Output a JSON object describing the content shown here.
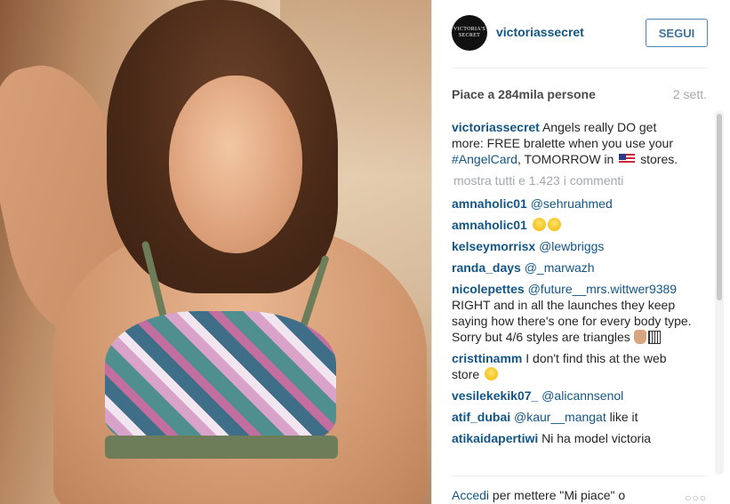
{
  "post": {
    "username": "victoriassecret",
    "avatar_text": "VICTORIA'S SECRET",
    "follow_label": "SEGUI",
    "likes_text": "Piace a 284mila persone",
    "time_text": "2 sett."
  },
  "caption": {
    "user": "victoriassecret",
    "text1": "Angels really DO get more: FREE bralette when you use your ",
    "hashtag": "#AngelCard",
    "text2": ", TOMORROW in ",
    "text3": " stores."
  },
  "show_all_text": "mostra tutti e 1.423 i commenti",
  "comments": [
    {
      "user": "amnaholic01",
      "mention": "@sehruahmed",
      "text": ""
    },
    {
      "user": "amnaholic01",
      "mention": "",
      "text": ""
    },
    {
      "user": "kelseymorrisx",
      "mention": "@lewbriggs",
      "text": ""
    },
    {
      "user": "randa_days",
      "mention": "@_marwazh",
      "text": ""
    },
    {
      "user": "nicolepettes",
      "mention": "@future__mrs.wittwer9389",
      "text": " RIGHT and in all the launches they keep saying how there's one for every body type. Sorry but 4/6 styles are triangles"
    },
    {
      "user": "cristtinamm",
      "mention": "",
      "text": " I don't find this at the web store"
    },
    {
      "user": "vesilekekik07_",
      "mention": "@alicannsenol",
      "text": ""
    },
    {
      "user": "atif_dubai",
      "mention": "@kaur__mangat",
      "text": " like it"
    },
    {
      "user": "atikaidapertiwi",
      "mention": "",
      "text": " Ni ha model victoria"
    }
  ],
  "footer": {
    "login_text": "Accedi",
    "rest_text": " per mettere \"Mi piace\" o",
    "dots": "○○○"
  },
  "icons": [
    "flag-us-icon",
    "grin-emoji-icon",
    "hand-emoji-icon",
    "tofu-glyph-icon",
    "sad-emoji-icon",
    "more-options-icon"
  ],
  "colors": {
    "link": "#125688",
    "follow_border": "#4b85b4",
    "muted": "#a5a7aa"
  }
}
